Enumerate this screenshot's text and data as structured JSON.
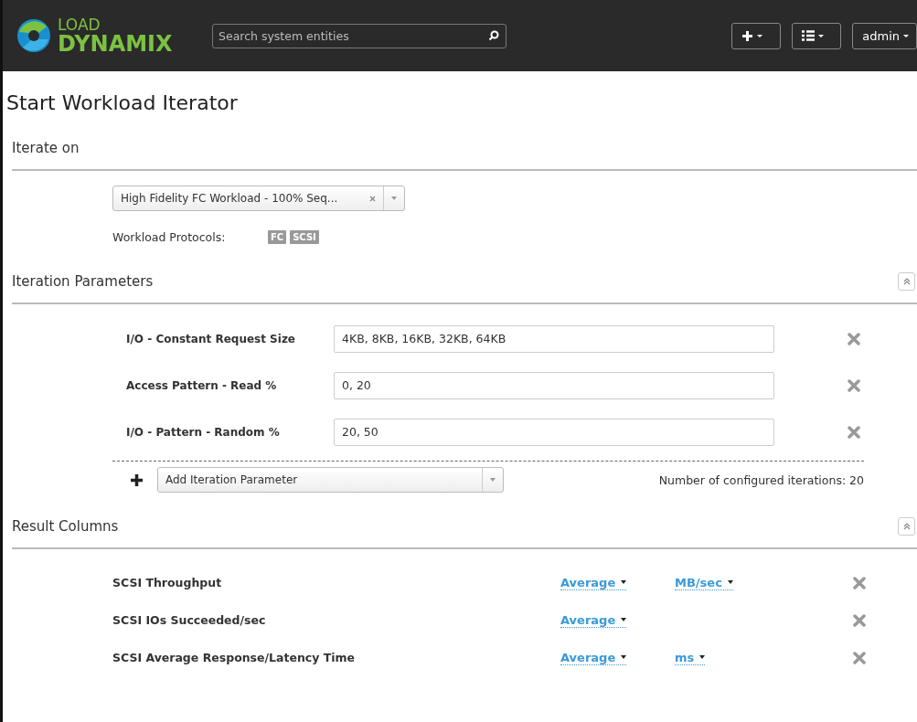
{
  "header": {
    "logo_top": "LOAD",
    "logo_bottom": "DYNAMIX",
    "search": {
      "placeholder": "Search system entities"
    },
    "user": "admin"
  },
  "title": "Start Workload Iterator",
  "iterate_on": {
    "heading": "Iterate on",
    "workload": "High Fidelity FC Workload - 100% Seq...",
    "protocols_label": "Workload Protocols:",
    "protocols": [
      "FC",
      "SCSI"
    ]
  },
  "iteration_parameters": {
    "heading": "Iteration Parameters",
    "expanded": true,
    "rows": [
      {
        "label": "I/O - Constant Request Size",
        "value": "4KB, 8KB, 16KB, 32KB, 64KB"
      },
      {
        "label": "Access Pattern - Read %",
        "value": "0, 20"
      },
      {
        "label": "I/O - Pattern - Random %",
        "value": "20, 50"
      }
    ],
    "add_placeholder": "Add Iteration Parameter",
    "count": "Number of configured iterations: 20"
  },
  "result_columns": {
    "heading": "Result Columns",
    "expanded": true,
    "rows": [
      {
        "label": "SCSI Throughput",
        "aggregate": "Average",
        "unit": "MB/sec"
      },
      {
        "label": "SCSI IOs Succeeded/sec",
        "aggregate": "Average"
      },
      {
        "label": "SCSI Average Response/Latency Time",
        "aggregate": "Average",
        "unit": "ms"
      }
    ]
  }
}
